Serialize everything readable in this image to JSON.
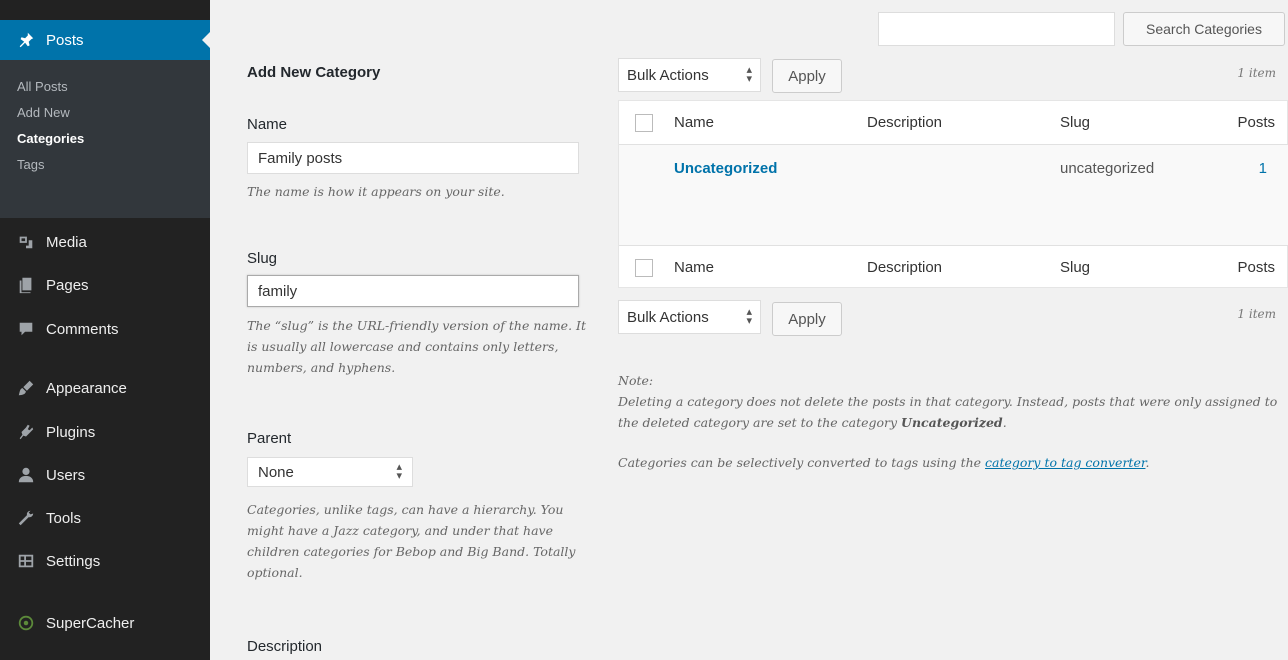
{
  "sidebar": {
    "active_menu": "Posts",
    "submenu": [
      "All Posts",
      "Add New",
      "Categories",
      "Tags"
    ],
    "current_submenu": "Categories",
    "menu": [
      {
        "label": "Media",
        "icon": "media-icon"
      },
      {
        "label": "Pages",
        "icon": "pages-icon"
      },
      {
        "label": "Comments",
        "icon": "comments-icon"
      },
      {
        "label": "Appearance",
        "icon": "appearance-icon"
      },
      {
        "label": "Plugins",
        "icon": "plugins-icon"
      },
      {
        "label": "Users",
        "icon": "users-icon"
      },
      {
        "label": "Tools",
        "icon": "tools-icon"
      },
      {
        "label": "Settings",
        "icon": "settings-icon"
      },
      {
        "label": "SuperCacher",
        "icon": "supercacher-icon"
      }
    ]
  },
  "form": {
    "heading": "Add New Category",
    "name_label": "Name",
    "name_value": "Family posts",
    "name_help": "The name is how it appears on your site.",
    "slug_label": "Slug",
    "slug_value": "family",
    "slug_help": "The “slug” is the URL-friendly version of the name. It is usually all lowercase and contains only letters, numbers, and hyphens.",
    "parent_label": "Parent",
    "parent_value": "None",
    "parent_help": "Categories, unlike tags, can have a hierarchy. You might have a Jazz category, and under that have children categories for Bebop and Big Band. Totally optional.",
    "description_label": "Description"
  },
  "search": {
    "placeholder": "",
    "button_label": "Search Categories"
  },
  "bulk": {
    "select_label": "Bulk Actions",
    "apply_label": "Apply",
    "count": "1 item"
  },
  "table": {
    "columns": {
      "name": "Name",
      "description": "Description",
      "slug": "Slug",
      "posts": "Posts"
    },
    "rows": [
      {
        "name": "Uncategorized",
        "description": "",
        "slug": "uncategorized",
        "posts": "1"
      }
    ]
  },
  "note": {
    "heading": "Note:",
    "line1_prefix": "Deleting a category does not delete the posts in that category. Instead, posts that were only assigned to the deleted category are set to the category ",
    "line1_bold": "Uncategorized",
    "line1_suffix": ".",
    "line2_prefix": "Categories can be selectively converted to tags using the ",
    "line2_link": "category to tag converter",
    "line2_suffix": "."
  },
  "colors": {
    "sidebar_bg": "#222222",
    "submenu_bg": "#32373c",
    "active_blue": "#0073aa",
    "page_bg": "#f1f1f1"
  }
}
